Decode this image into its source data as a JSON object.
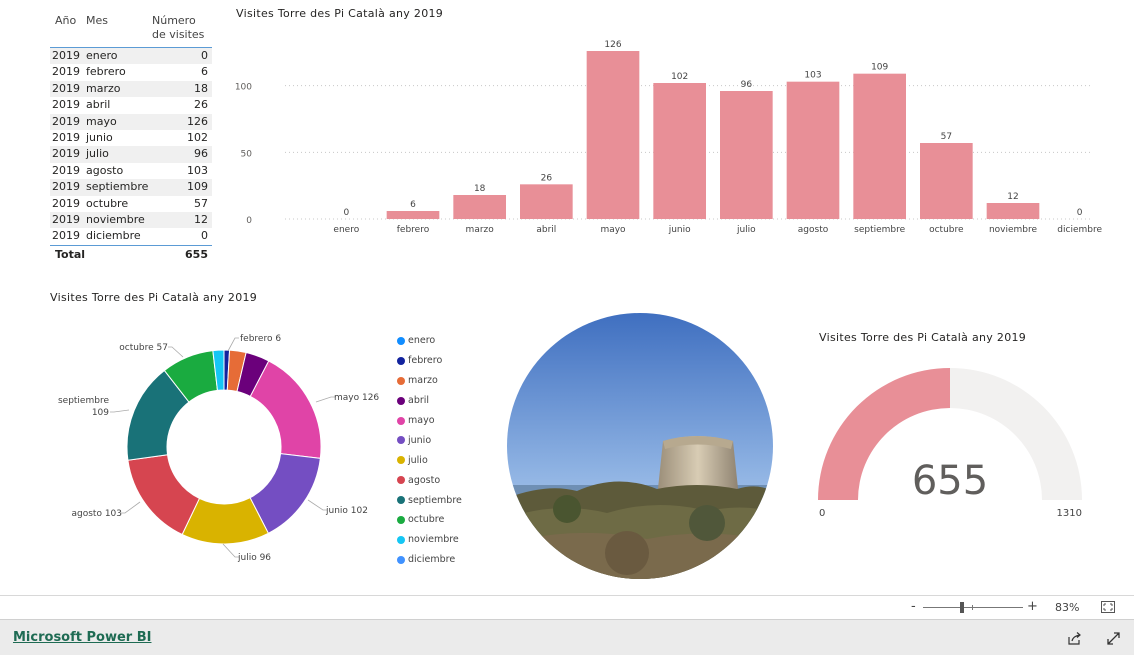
{
  "table": {
    "headers": {
      "year": "Año",
      "month": "Mes",
      "visits_line1": "Número",
      "visits_line2": "de visites"
    },
    "rows": [
      {
        "year": "2019",
        "month": "enero",
        "visits": "0"
      },
      {
        "year": "2019",
        "month": "febrero",
        "visits": "6"
      },
      {
        "year": "2019",
        "month": "marzo",
        "visits": "18"
      },
      {
        "year": "2019",
        "month": "abril",
        "visits": "26"
      },
      {
        "year": "2019",
        "month": "mayo",
        "visits": "126"
      },
      {
        "year": "2019",
        "month": "junio",
        "visits": "102"
      },
      {
        "year": "2019",
        "month": "julio",
        "visits": "96"
      },
      {
        "year": "2019",
        "month": "agosto",
        "visits": "103"
      },
      {
        "year": "2019",
        "month": "septiembre",
        "visits": "109"
      },
      {
        "year": "2019",
        "month": "octubre",
        "visits": "57"
      },
      {
        "year": "2019",
        "month": "noviembre",
        "visits": "12"
      },
      {
        "year": "2019",
        "month": "diciembre",
        "visits": "0"
      }
    ],
    "total_label": "Total",
    "total_value": "655"
  },
  "chart_data": [
    {
      "type": "bar",
      "title": "Visites Torre des Pi Català any 2019",
      "categories": [
        "enero",
        "febrero",
        "marzo",
        "abril",
        "mayo",
        "junio",
        "julio",
        "agosto",
        "septiembre",
        "octubre",
        "noviembre",
        "diciembre"
      ],
      "values": [
        0,
        6,
        18,
        26,
        126,
        102,
        96,
        103,
        109,
        57,
        12,
        0
      ],
      "ylim": [
        0,
        135
      ],
      "yticks": [
        0,
        50,
        100
      ],
      "color": "#e88f97",
      "grid": true
    },
    {
      "type": "pie",
      "title": "Visites Torre des Pi Català any 2019",
      "donut": true,
      "categories": [
        "enero",
        "febrero",
        "marzo",
        "abril",
        "mayo",
        "junio",
        "julio",
        "agosto",
        "septiembre",
        "octubre",
        "noviembre",
        "diciembre"
      ],
      "values": [
        0,
        6,
        18,
        26,
        126,
        102,
        96,
        103,
        109,
        57,
        12,
        0
      ],
      "colors": [
        "#118dff",
        "#12239e",
        "#e66c37",
        "#6b007b",
        "#e044a7",
        "#744ec2",
        "#d9b300",
        "#d64550",
        "#197278",
        "#1aab40",
        "#15c6f4",
        "#4092ff"
      ],
      "callouts": [
        "febrero 6",
        "mayo 126",
        "junio 102",
        "julio 96",
        "agosto 103",
        "septiembre",
        "109",
        "octubre 57"
      ],
      "legend_position": "right"
    },
    {
      "type": "gauge",
      "title": "Visites Torre des Pi Català any 2019",
      "value": 655,
      "value_label": "655",
      "min": 0,
      "max": 1310,
      "min_label": "0",
      "max_label": "1310",
      "fill_color": "#e88f97",
      "track_color": "#f2f1f0"
    }
  ],
  "zoom": {
    "minus": "-",
    "plus": "+",
    "level": "83%"
  },
  "footer": {
    "link_label": "Microsoft Power BI"
  },
  "icons": {
    "fit": "fit-to-page-icon",
    "share": "share-icon",
    "expand": "expand-icon"
  }
}
